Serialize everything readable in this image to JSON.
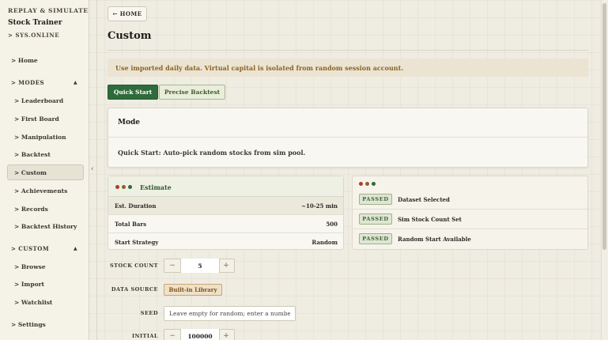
{
  "sidebar": {
    "kicker": "REPLAY & SIMULATE",
    "title": "Stock Trainer",
    "status": "> SYS.ONLINE",
    "items": {
      "home": "> Home",
      "modes": "> MODES",
      "leaderboard": "> Leaderboard",
      "first_board": "> First Board",
      "manipulation": "> Manipulation",
      "backtest": "> Backtest",
      "custom": "> Custom",
      "achievements": "> Achievements",
      "records": "> Records",
      "backtest_history": "> Backtest History",
      "custom_section": "> CUSTOM",
      "browse": "> Browse",
      "import": "> Import",
      "watchlist": "> Watchlist",
      "settings": "> Settings"
    },
    "caret": "▲",
    "collapse": "‹"
  },
  "header": {
    "home_button": "← HOME",
    "title": "Custom"
  },
  "notice": "Use imported daily data. Virtual capital is isolated from random session account.",
  "tabs": {
    "quick": "Quick Start",
    "precise": "Precise Backtest"
  },
  "mode": {
    "title": "Mode",
    "description": "Quick Start: Auto-pick random stocks from sim pool."
  },
  "estimate": {
    "title": "Estimate",
    "rows": [
      {
        "label": "Est. Duration",
        "value": "~10-25 min"
      },
      {
        "label": "Total Bars",
        "value": "500"
      },
      {
        "label": "Start Strategy",
        "value": "Random"
      }
    ]
  },
  "checks": {
    "badge": "PASSED",
    "items": [
      "Dataset Selected",
      "Sim Stock Count Set",
      "Random Start Available"
    ]
  },
  "form": {
    "stock_count": {
      "label": "STOCK COUNT",
      "value": "5",
      "minus": "−",
      "plus": "+"
    },
    "data_source": {
      "label": "DATA SOURCE",
      "value": "Built-in Library"
    },
    "seed": {
      "label": "SEED",
      "placeholder": "Leave empty for random; enter a number"
    },
    "initial_capital": {
      "label": "INITIAL CAPITAL",
      "value": "100000",
      "minus": "−",
      "plus": "+"
    }
  },
  "colors": {
    "dot_red": "#b23a2e",
    "dot_brown": "#8a6328",
    "dot_green": "#2f6a3b",
    "accent_green": "#2f6a3b"
  }
}
